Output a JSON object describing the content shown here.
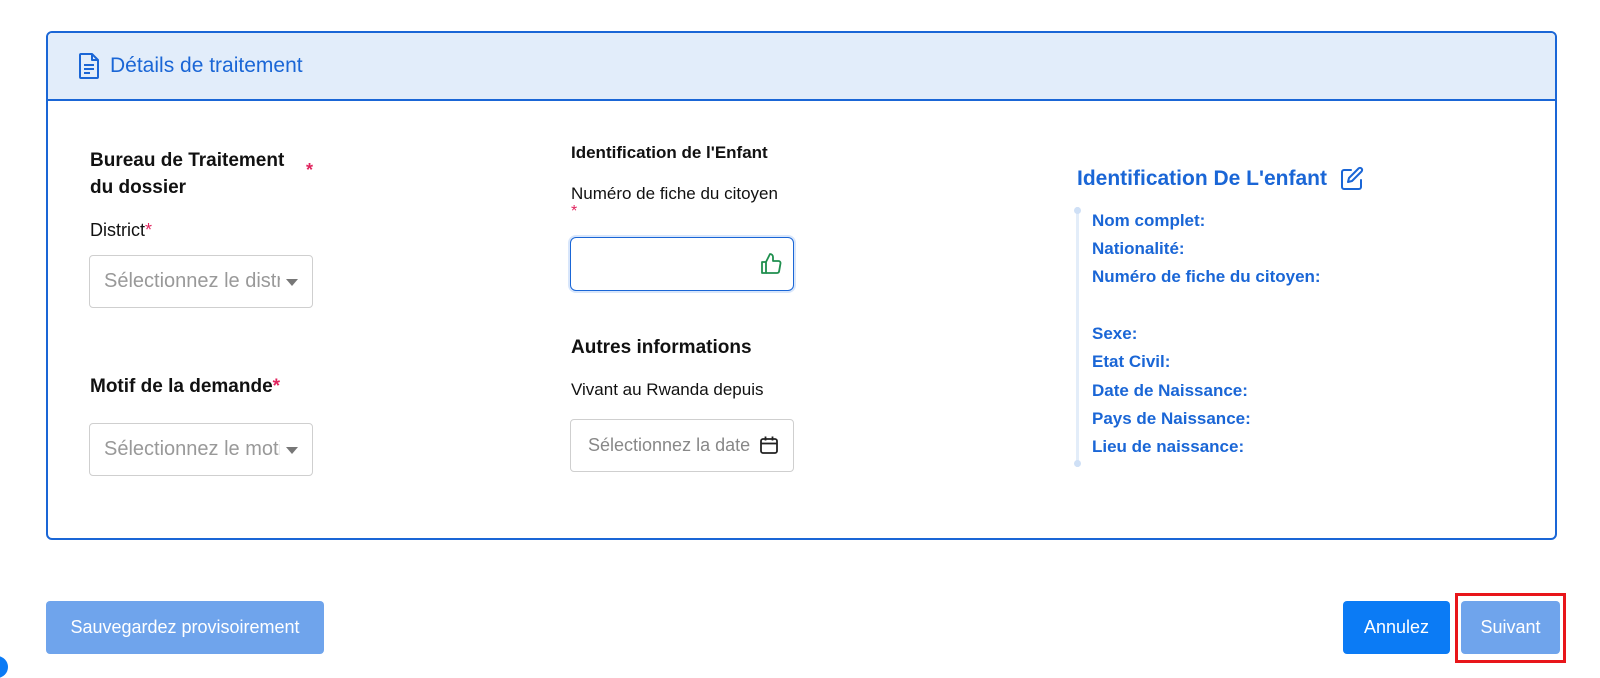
{
  "card": {
    "title": "Détails de traitement",
    "icon": "document-icon"
  },
  "bureau": {
    "label_line1": "Bureau de Traitement",
    "label_line2": "du dossier",
    "required": "*",
    "district_label": "District",
    "district_placeholder": "Sélectionnez le district"
  },
  "motif": {
    "label": "Motif de la demande",
    "required": "*",
    "placeholder": "Sélectionnez le motif"
  },
  "child_id": {
    "heading": "Identification de l'Enfant",
    "fiche_label": "Numéro de fiche du citoyen",
    "required": "*",
    "fiche_value": "",
    "icon": "thumbs-up-icon"
  },
  "autres": {
    "heading": "Autres informations",
    "vivant_label": "Vivant au Rwanda depuis",
    "date_placeholder": "Sélectionnez la date",
    "icon": "calendar-icon"
  },
  "summary": {
    "title": "Identification De L'enfant",
    "icon": "edit-icon",
    "fields": {
      "nom": "Nom complet:",
      "nationalite": "Nationalité:",
      "fiche": "Numéro de fiche du citoyen:",
      "sexe": "Sexe:",
      "etat_civil": "Etat Civil:",
      "date_naissance": "Date de Naissance:",
      "pays_naissance": "Pays de Naissance:",
      "lieu_naissance": "Lieu de naissance:"
    }
  },
  "actions": {
    "save_draft": "Sauvegardez provisoirement",
    "cancel": "Annulez",
    "next": "Suivant"
  },
  "colors": {
    "primary": "#1a66d6",
    "button_blue": "#0b7bf5",
    "button_light": "#6fa4ec",
    "required": "#e0245e",
    "highlight": "#e8161a"
  }
}
